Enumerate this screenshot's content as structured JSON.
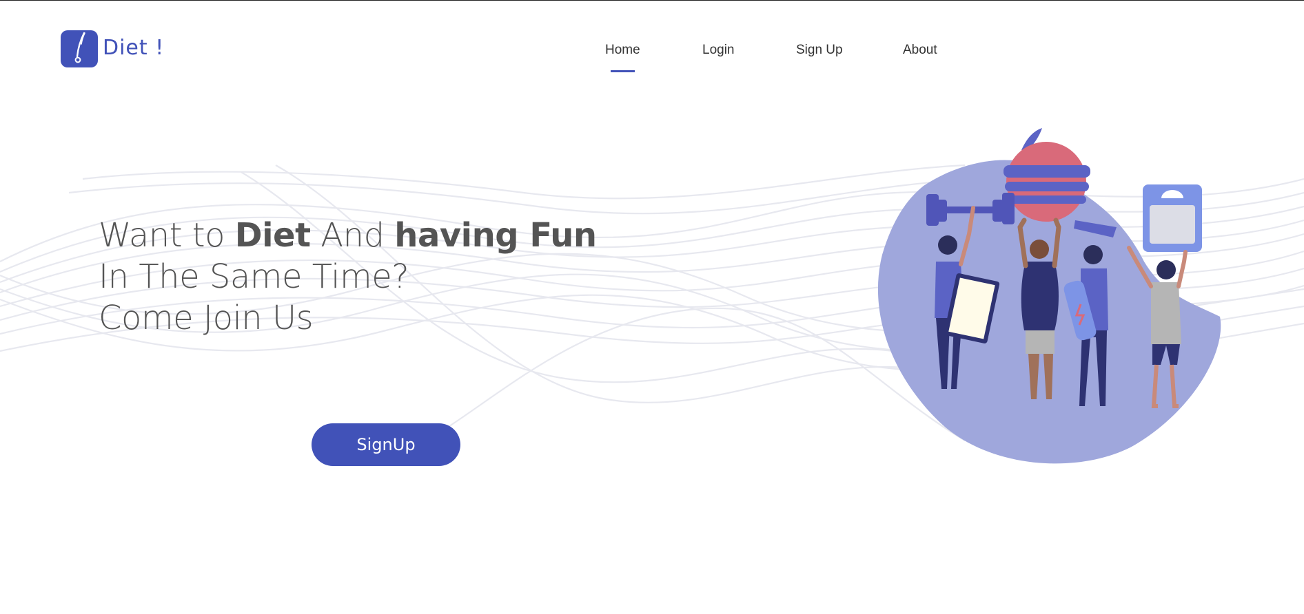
{
  "brand": {
    "name": "Diet !",
    "accent_color": "#4152b8",
    "icon": "diet-logo-icon"
  },
  "nav": {
    "items": [
      {
        "label": "Home",
        "active": true
      },
      {
        "label": "Login",
        "active": false
      },
      {
        "label": "Sign Up",
        "active": false
      },
      {
        "label": "About",
        "active": false
      }
    ]
  },
  "hero": {
    "line1_a": "Want to ",
    "line1_b": "Diet",
    "line1_c": " And ",
    "line1_d": "having Fun",
    "line2": "In The Same Time?",
    "line3": "Come Join Us",
    "cta_label": "SignUp"
  },
  "illustration": {
    "icon": "fitness-people-illustration"
  }
}
